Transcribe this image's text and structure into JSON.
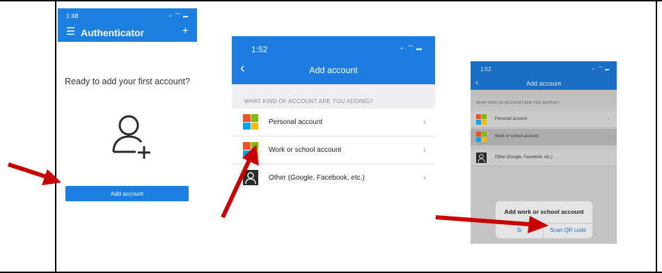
{
  "screens": [
    {
      "status_time": "1:48",
      "status_icons": "▪ᐧ ⌒ ▬",
      "menu_icon": "hamburger-icon",
      "app_title": "Authenticator",
      "header_plus": "+",
      "empty_message": "Ready to add your first account?",
      "illustration_icon": "person-add-icon",
      "add_button_label": "Add account"
    },
    {
      "status_time": "1:52",
      "status_icons": "▪ᐧ ⌒ ▬",
      "back_icon": "‹",
      "title": "Add account",
      "section_header": "WHAT KIND OF ACCOUNT ARE YOU ADDING?",
      "options": [
        {
          "label": "Personal account",
          "icon": "microsoft-logo-icon",
          "chevron": "›"
        },
        {
          "label": "Work or school account",
          "icon": "microsoft-logo-icon",
          "chevron": "›"
        },
        {
          "label": "Other (Google, Facebook, etc.)",
          "icon": "person-icon",
          "chevron": "›"
        }
      ]
    },
    {
      "status_time": "1:52",
      "status_icons": "▪ᐧ ⌒ ▬",
      "back_icon": "‹",
      "title": "Add account",
      "section_header": "WHAT KIND OF ACCOUNT ARE YOU ADDING?",
      "options": [
        {
          "label": "Personal account",
          "chevron": "›"
        },
        {
          "label": "Work or school account",
          "chevron": "›",
          "highlighted": true
        },
        {
          "label": "Other (Google, Facebook, etc.)",
          "chevron": "›"
        }
      ],
      "dialog": {
        "title": "Add work or school account",
        "option_left": "Si",
        "option_right": "Scan QR code"
      }
    }
  ],
  "colors": {
    "brand_blue": "#1d7fe0",
    "arrow_red": "#c80000",
    "ms_red": "#f25022",
    "ms_green": "#7fba00",
    "ms_blue": "#00a4ef",
    "ms_yellow": "#ffb900"
  }
}
